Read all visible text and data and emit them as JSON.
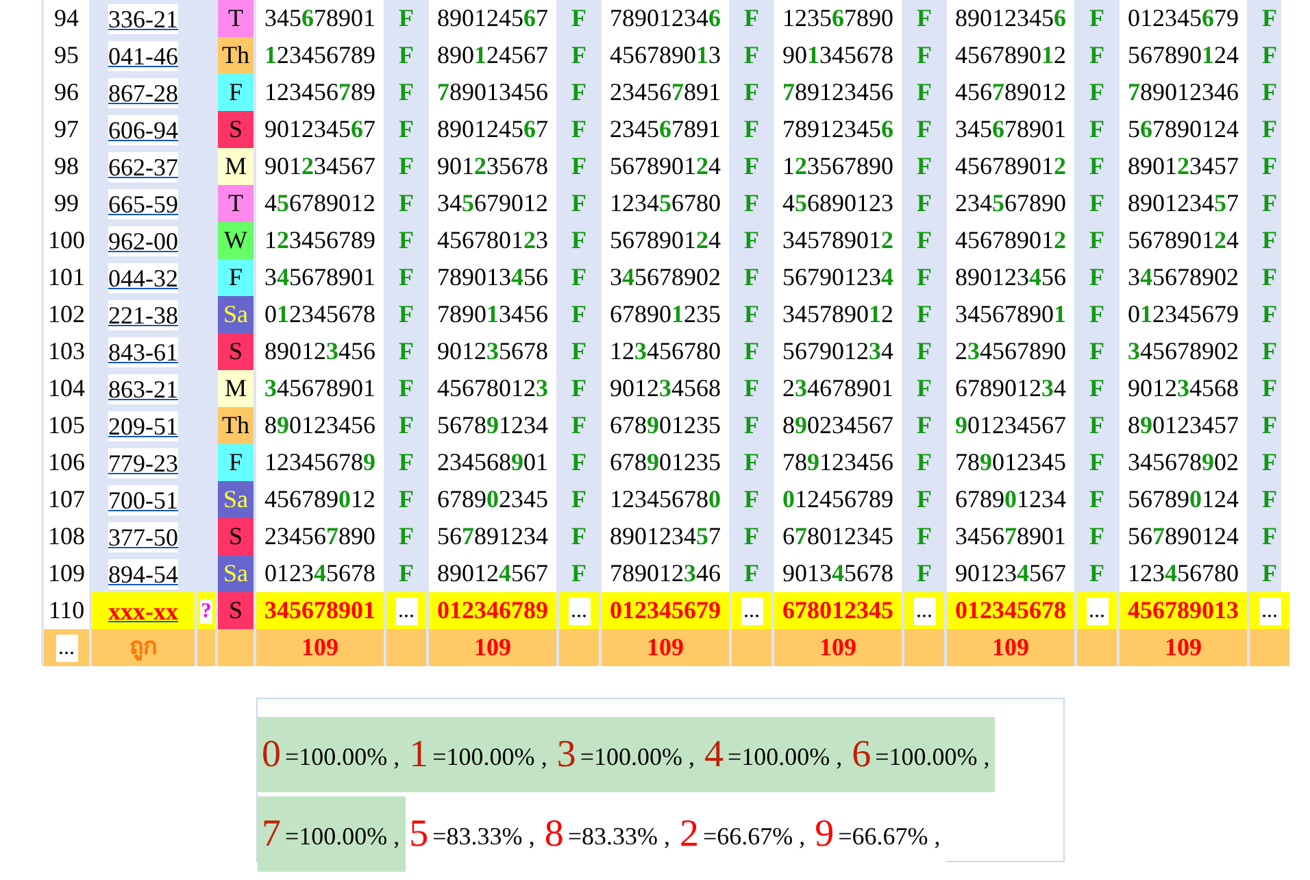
{
  "rows": [
    {
      "kind": "done",
      "no": "94",
      "code": "336-21",
      "day": "T",
      "color": "#ff88ee",
      "light_text": false,
      "cells": [
        {
          "number": "345**6**78901",
          "result": "F"
        },
        {
          "number": "8901245**6**7",
          "result": "F"
        },
        {
          "number": "78901234**6**",
          "result": "F"
        },
        {
          "number": "1235**6**7890",
          "result": "F"
        },
        {
          "number": "89012345**6**",
          "result": "F"
        },
        {
          "number": "012345**6**79",
          "result": "F"
        }
      ]
    },
    {
      "kind": "done",
      "no": "95",
      "code": "041-46",
      "day": "Th",
      "color": "#ffc864",
      "light_text": false,
      "cells": [
        {
          "number": "**1**23456789",
          "result": "F"
        },
        {
          "number": "890**1**24567",
          "result": "F"
        },
        {
          "number": "4567890**1**3",
          "result": "F"
        },
        {
          "number": "90**1**345678",
          "result": "F"
        },
        {
          "number": "4567890**1**2",
          "result": "F"
        },
        {
          "number": "567890**1**24",
          "result": "F"
        }
      ]
    },
    {
      "kind": "done",
      "no": "96",
      "code": "867-28",
      "day": "F",
      "color": "#66ffff",
      "light_text": false,
      "cells": [
        {
          "number": "123456**7**89",
          "result": "F"
        },
        {
          "number": "**7**89013456",
          "result": "F"
        },
        {
          "number": "23456**7**891",
          "result": "F"
        },
        {
          "number": "**7**89123456",
          "result": "F"
        },
        {
          "number": "456**7**89012",
          "result": "F"
        },
        {
          "number": "**7**89012346",
          "result": "F"
        }
      ]
    },
    {
      "kind": "done",
      "no": "97",
      "code": "606-94",
      "day": "S",
      "color": "#ff3366",
      "light_text": false,
      "cells": [
        {
          "number": "9012345**6**7",
          "result": "F"
        },
        {
          "number": "8901245**6**7",
          "result": "F"
        },
        {
          "number": "2345**6**7891",
          "result": "F"
        },
        {
          "number": "78912345**6**",
          "result": "F"
        },
        {
          "number": "345**6**78901",
          "result": "F"
        },
        {
          "number": "5**6**7890124",
          "result": "F"
        }
      ]
    },
    {
      "kind": "done",
      "no": "98",
      "code": "662-37",
      "day": "M",
      "color": "#ffffcc",
      "light_text": false,
      "cells": [
        {
          "number": "901**2**34567",
          "result": "F"
        },
        {
          "number": "901**2**35678",
          "result": "F"
        },
        {
          "number": "5678901**2**4",
          "result": "F"
        },
        {
          "number": "1**2**3567890",
          "result": "F"
        },
        {
          "number": "45678901**2**",
          "result": "F"
        },
        {
          "number": "8901**2**3457",
          "result": "F"
        }
      ]
    },
    {
      "kind": "done",
      "no": "99",
      "code": "665-59",
      "day": "T",
      "color": "#ff88ee",
      "light_text": false,
      "cells": [
        {
          "number": "4**5**6789012",
          "result": "F"
        },
        {
          "number": "34**5**679012",
          "result": "F"
        },
        {
          "number": "1234**5**6780",
          "result": "F"
        },
        {
          "number": "4**5**6890123",
          "result": "F"
        },
        {
          "number": "234**5**67890",
          "result": "F"
        },
        {
          "number": "8901234**5**7",
          "result": "F"
        }
      ]
    },
    {
      "kind": "done",
      "no": "100",
      "code": "962-00",
      "day": "W",
      "color": "#66ff66",
      "light_text": false,
      "cells": [
        {
          "number": "1**2**3456789",
          "result": "F"
        },
        {
          "number": "4567801**2**3",
          "result": "F"
        },
        {
          "number": "5678901**2**4",
          "result": "F"
        },
        {
          "number": "34578901**2**",
          "result": "F"
        },
        {
          "number": "45678901**2**",
          "result": "F"
        },
        {
          "number": "5678901**2**4",
          "result": "F"
        }
      ]
    },
    {
      "kind": "done",
      "no": "101",
      "code": "044-32",
      "day": "F",
      "color": "#66ffff",
      "light_text": false,
      "cells": [
        {
          "number": "3**4**5678901",
          "result": "F"
        },
        {
          "number": "789013**4**56",
          "result": "F"
        },
        {
          "number": "3**4**5678902",
          "result": "F"
        },
        {
          "number": "56790123**4**",
          "result": "F"
        },
        {
          "number": "890123**4**56",
          "result": "F"
        },
        {
          "number": "3**4**5678902",
          "result": "F"
        }
      ]
    },
    {
      "kind": "done",
      "no": "102",
      "code": "221-38",
      "day": "Sa",
      "color": "#6666cc",
      "light_text": true,
      "cells": [
        {
          "number": "0**1**2345678",
          "result": "F"
        },
        {
          "number": "7890**1**3456",
          "result": "F"
        },
        {
          "number": "67890**1**235",
          "result": "F"
        },
        {
          "number": "3457890**1**2",
          "result": "F"
        },
        {
          "number": "34567890**1**",
          "result": "F"
        },
        {
          "number": "0**1**2345679",
          "result": "F"
        }
      ]
    },
    {
      "kind": "done",
      "no": "103",
      "code": "843-61",
      "day": "S",
      "color": "#ff3366",
      "light_text": false,
      "cells": [
        {
          "number": "89012**3**456",
          "result": "F"
        },
        {
          "number": "9012**3**5678",
          "result": "F"
        },
        {
          "number": "12**3**456780",
          "result": "F"
        },
        {
          "number": "5679012**3**4",
          "result": "F"
        },
        {
          "number": "2**3**4567890",
          "result": "F"
        },
        {
          "number": "**3**45678902",
          "result": "F"
        }
      ]
    },
    {
      "kind": "done",
      "no": "104",
      "code": "863-21",
      "day": "M",
      "color": "#ffffcc",
      "light_text": false,
      "cells": [
        {
          "number": "**3**45678901",
          "result": "F"
        },
        {
          "number": "45678012**3**",
          "result": "F"
        },
        {
          "number": "9012**3**4568",
          "result": "F"
        },
        {
          "number": "2**3**4678901",
          "result": "F"
        },
        {
          "number": "6789012**3**4",
          "result": "F"
        },
        {
          "number": "9012**3**4568",
          "result": "F"
        }
      ]
    },
    {
      "kind": "done",
      "no": "105",
      "code": "209-51",
      "day": "Th",
      "color": "#ffc864",
      "light_text": false,
      "cells": [
        {
          "number": "8**9**0123456",
          "result": "F"
        },
        {
          "number": "5678**9**1234",
          "result": "F"
        },
        {
          "number": "678**9**01235",
          "result": "F"
        },
        {
          "number": "8**9**0234567",
          "result": "F"
        },
        {
          "number": "**9**01234567",
          "result": "F"
        },
        {
          "number": "8**9**0123457",
          "result": "F"
        }
      ]
    },
    {
      "kind": "done",
      "no": "106",
      "code": "779-23",
      "day": "F",
      "color": "#66ffff",
      "light_text": false,
      "cells": [
        {
          "number": "12345678**9**",
          "result": "F"
        },
        {
          "number": "234568**9**01",
          "result": "F"
        },
        {
          "number": "678**9**01235",
          "result": "F"
        },
        {
          "number": "78**9**123456",
          "result": "F"
        },
        {
          "number": "78**9**012345",
          "result": "F"
        },
        {
          "number": "345678**9**02",
          "result": "F"
        }
      ]
    },
    {
      "kind": "done",
      "no": "107",
      "code": "700-51",
      "day": "Sa",
      "color": "#6666cc",
      "light_text": true,
      "cells": [
        {
          "number": "456789**0**12",
          "result": "F"
        },
        {
          "number": "6789**0**2345",
          "result": "F"
        },
        {
          "number": "12345678**0**",
          "result": "F"
        },
        {
          "number": "**0**12456789",
          "result": "F"
        },
        {
          "number": "6789**0**1234",
          "result": "F"
        },
        {
          "number": "56789**0**124",
          "result": "F"
        }
      ]
    },
    {
      "kind": "done",
      "no": "108",
      "code": "377-50",
      "day": "S",
      "color": "#ff3366",
      "light_text": false,
      "cells": [
        {
          "number": "23456**7**890",
          "result": "F"
        },
        {
          "number": "56**7**891234",
          "result": "F"
        },
        {
          "number": "8901234**5**7",
          "result": "F"
        },
        {
          "number": "6**7**8012345",
          "result": "F"
        },
        {
          "number": "3456**7**8901",
          "result": "F"
        },
        {
          "number": "56**7**890124",
          "result": "F"
        }
      ]
    },
    {
      "kind": "done",
      "no": "109",
      "code": "894-54",
      "day": "Sa",
      "color": "#6666cc",
      "light_text": true,
      "cells": [
        {
          "number": "0123**4**5678",
          "result": "F"
        },
        {
          "number": "89012**4**567",
          "result": "F"
        },
        {
          "number": "789012**3**46",
          "result": "F"
        },
        {
          "number": "9013**4**5678",
          "result": "F"
        },
        {
          "number": "90123**4**567",
          "result": "F"
        },
        {
          "number": "123**4**56780",
          "result": "F"
        }
      ]
    },
    {
      "kind": "pending",
      "no": "110",
      "code": "xxx-xx",
      "flag": "?",
      "day": "S",
      "color": "#ff3366",
      "light_text": false,
      "cells": [
        {
          "number": "345678901",
          "result": "..."
        },
        {
          "number": "012346789",
          "result": "..."
        },
        {
          "number": "012345679",
          "result": "..."
        },
        {
          "number": "678012345",
          "result": "..."
        },
        {
          "number": "012345678",
          "result": "..."
        },
        {
          "number": "456789013",
          "result": "..."
        }
      ]
    }
  ],
  "footer": {
    "index": "...",
    "label": "ถูก",
    "counts": [
      "109",
      "109",
      "109",
      "109",
      "109",
      "109"
    ]
  },
  "legend": [
    {
      "digit": "0",
      "value": "=100.00%",
      "sep": ",",
      "highlighted": true
    },
    {
      "digit": "1",
      "value": "=100.00%",
      "sep": ",",
      "highlighted": true
    },
    {
      "digit": "3",
      "value": "=100.00%",
      "sep": ",",
      "highlighted": true
    },
    {
      "digit": "4",
      "value": "=100.00%",
      "sep": ",",
      "highlighted": true
    },
    {
      "digit": "6",
      "value": "=100.00%",
      "sep": ",",
      "highlighted": true
    },
    {
      "digit": "7",
      "value": "=100.00%",
      "sep": ",",
      "highlighted": true
    },
    {
      "digit": "5",
      "value": "=83.33%",
      "sep": ",",
      "highlighted": false
    },
    {
      "digit": "8",
      "value": "=83.33%",
      "sep": ",",
      "highlighted": false
    },
    {
      "digit": "2",
      "value": "=66.67%",
      "sep": ",",
      "highlighted": false
    },
    {
      "digit": "9",
      "value": "=66.67%",
      "sep": ",",
      "highlighted": false
    }
  ]
}
